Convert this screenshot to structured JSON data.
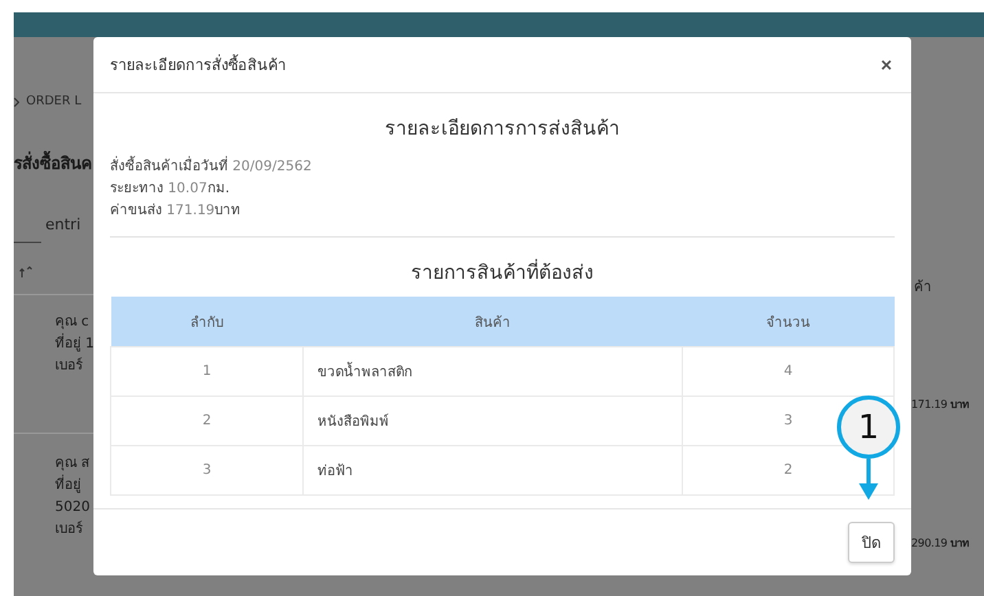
{
  "background_page": {
    "breadcrumb": "ORDER L",
    "heading": "รสั่งซื้อสินค",
    "entries_label": "entri",
    "column_header": "ค้า",
    "rows": [
      {
        "lines": [
          "คุณ c",
          "ที่อยู่ 1",
          "เบอร์"
        ],
        "amount": "171.19 **บาท**"
      },
      {
        "lines": [
          "คุณ ส",
          "ที่อยู่",
          "5020",
          "เบอร์"
        ],
        "amount": "290.19 **บาท**"
      }
    ]
  },
  "modal": {
    "title": "รายละเอียดการสั่งซื้อสินค้า",
    "close": "×",
    "heading": "รายละเอียดการการส่งสินค้า",
    "info": [
      {
        "label": "สั่งซื้อสินค้าเมื่อวันที่",
        "value": "20/09/2562"
      },
      {
        "label": "ระยะทาง",
        "value": "10.07",
        "unit": "กม."
      },
      {
        "label": "ค่าขนส่ง",
        "value": "171.19",
        "unit": "บาท"
      }
    ],
    "items_heading": "รายการสินค้าที่ต้องส่ง",
    "table": {
      "columns": [
        "ลำกับ",
        "สินค้า",
        "จำนวน"
      ],
      "rows": [
        [
          "1",
          "ขวดน้ำพลาสติก",
          "4"
        ],
        [
          "2",
          "หนังสือพิมพ์",
          "3"
        ],
        [
          "3",
          "ท่อฟ้า",
          "2"
        ]
      ]
    },
    "close_button": "ปิด"
  },
  "callout": {
    "label": "1"
  }
}
